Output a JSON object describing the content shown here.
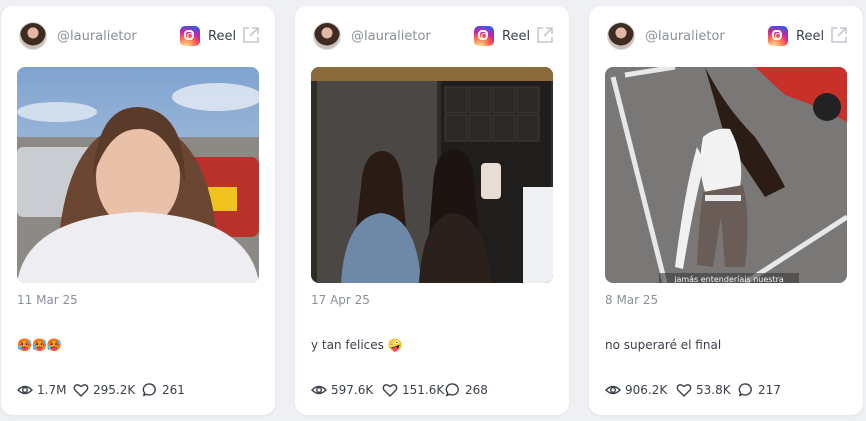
{
  "cards": [
    {
      "handle": "@lauralietor",
      "type_label": "Reel",
      "date": "11 Mar 25",
      "caption": "🥵🥵🥵",
      "views": "1.7M",
      "likes": "295.2K",
      "comments": "261"
    },
    {
      "handle": "@lauralietor",
      "type_label": "Reel",
      "date": "17 Apr 25",
      "caption": "y tan felices 🤪",
      "views": "597.6K",
      "likes": "151.6K",
      "comments": "268"
    },
    {
      "handle": "@lauralietor",
      "type_label": "Reel",
      "date": "8 Mar 25",
      "caption": "no superaré el final",
      "media_overlay_text": "jamás entenderíais nuestra",
      "views": "906.2K",
      "likes": "53.8K",
      "comments": "217"
    }
  ],
  "icons": {
    "views": "eye-icon",
    "likes": "heart-icon",
    "comments": "comment-icon",
    "platform": "instagram-icon",
    "open": "external-link-icon"
  }
}
